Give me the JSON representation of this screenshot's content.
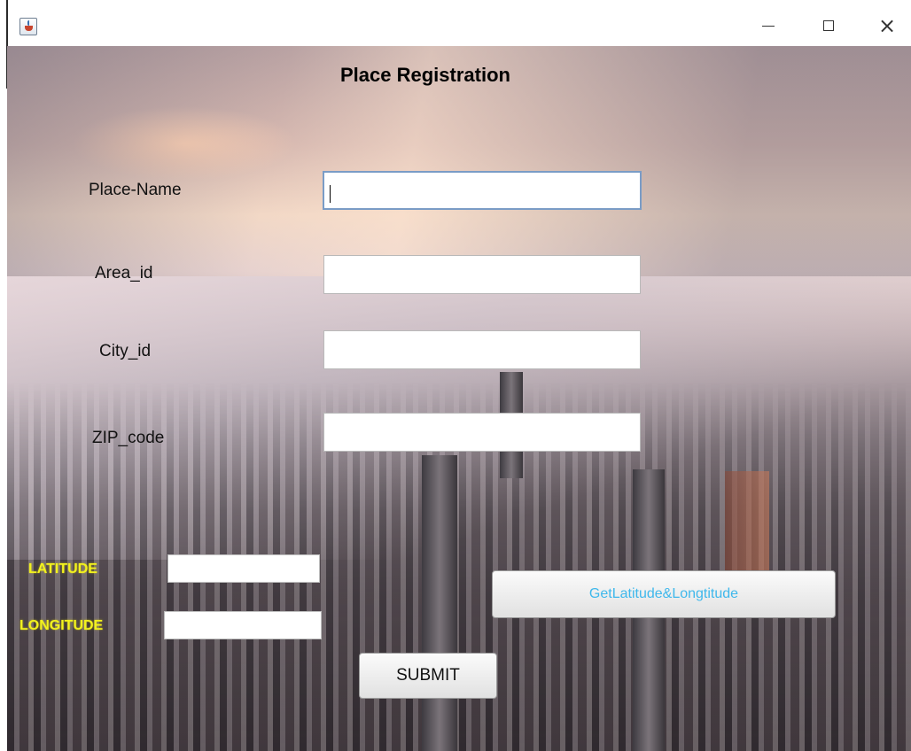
{
  "window": {
    "icon": "java-cup-icon",
    "controls": {
      "minimize": "minimize-icon",
      "maximize": "maximize-icon",
      "close_glyph": "×"
    }
  },
  "form": {
    "title": "Place Registration",
    "fields": [
      {
        "label": "Place-Name",
        "value": ""
      },
      {
        "label": "Area_id",
        "value": ""
      },
      {
        "label": "City_id",
        "value": ""
      },
      {
        "label": "ZIP_code",
        "value": ""
      }
    ],
    "coordinates": {
      "latitude_label": "LATITUDE",
      "longitude_label": "LONGITUDE",
      "latitude_value": "",
      "longitude_value": ""
    },
    "buttons": {
      "get_coords": "GetLatitude&Longtitude",
      "submit": "SUBMIT"
    }
  },
  "colors": {
    "coord_label": "#f2f21e",
    "geo_button_text": "#3fb8ec"
  }
}
